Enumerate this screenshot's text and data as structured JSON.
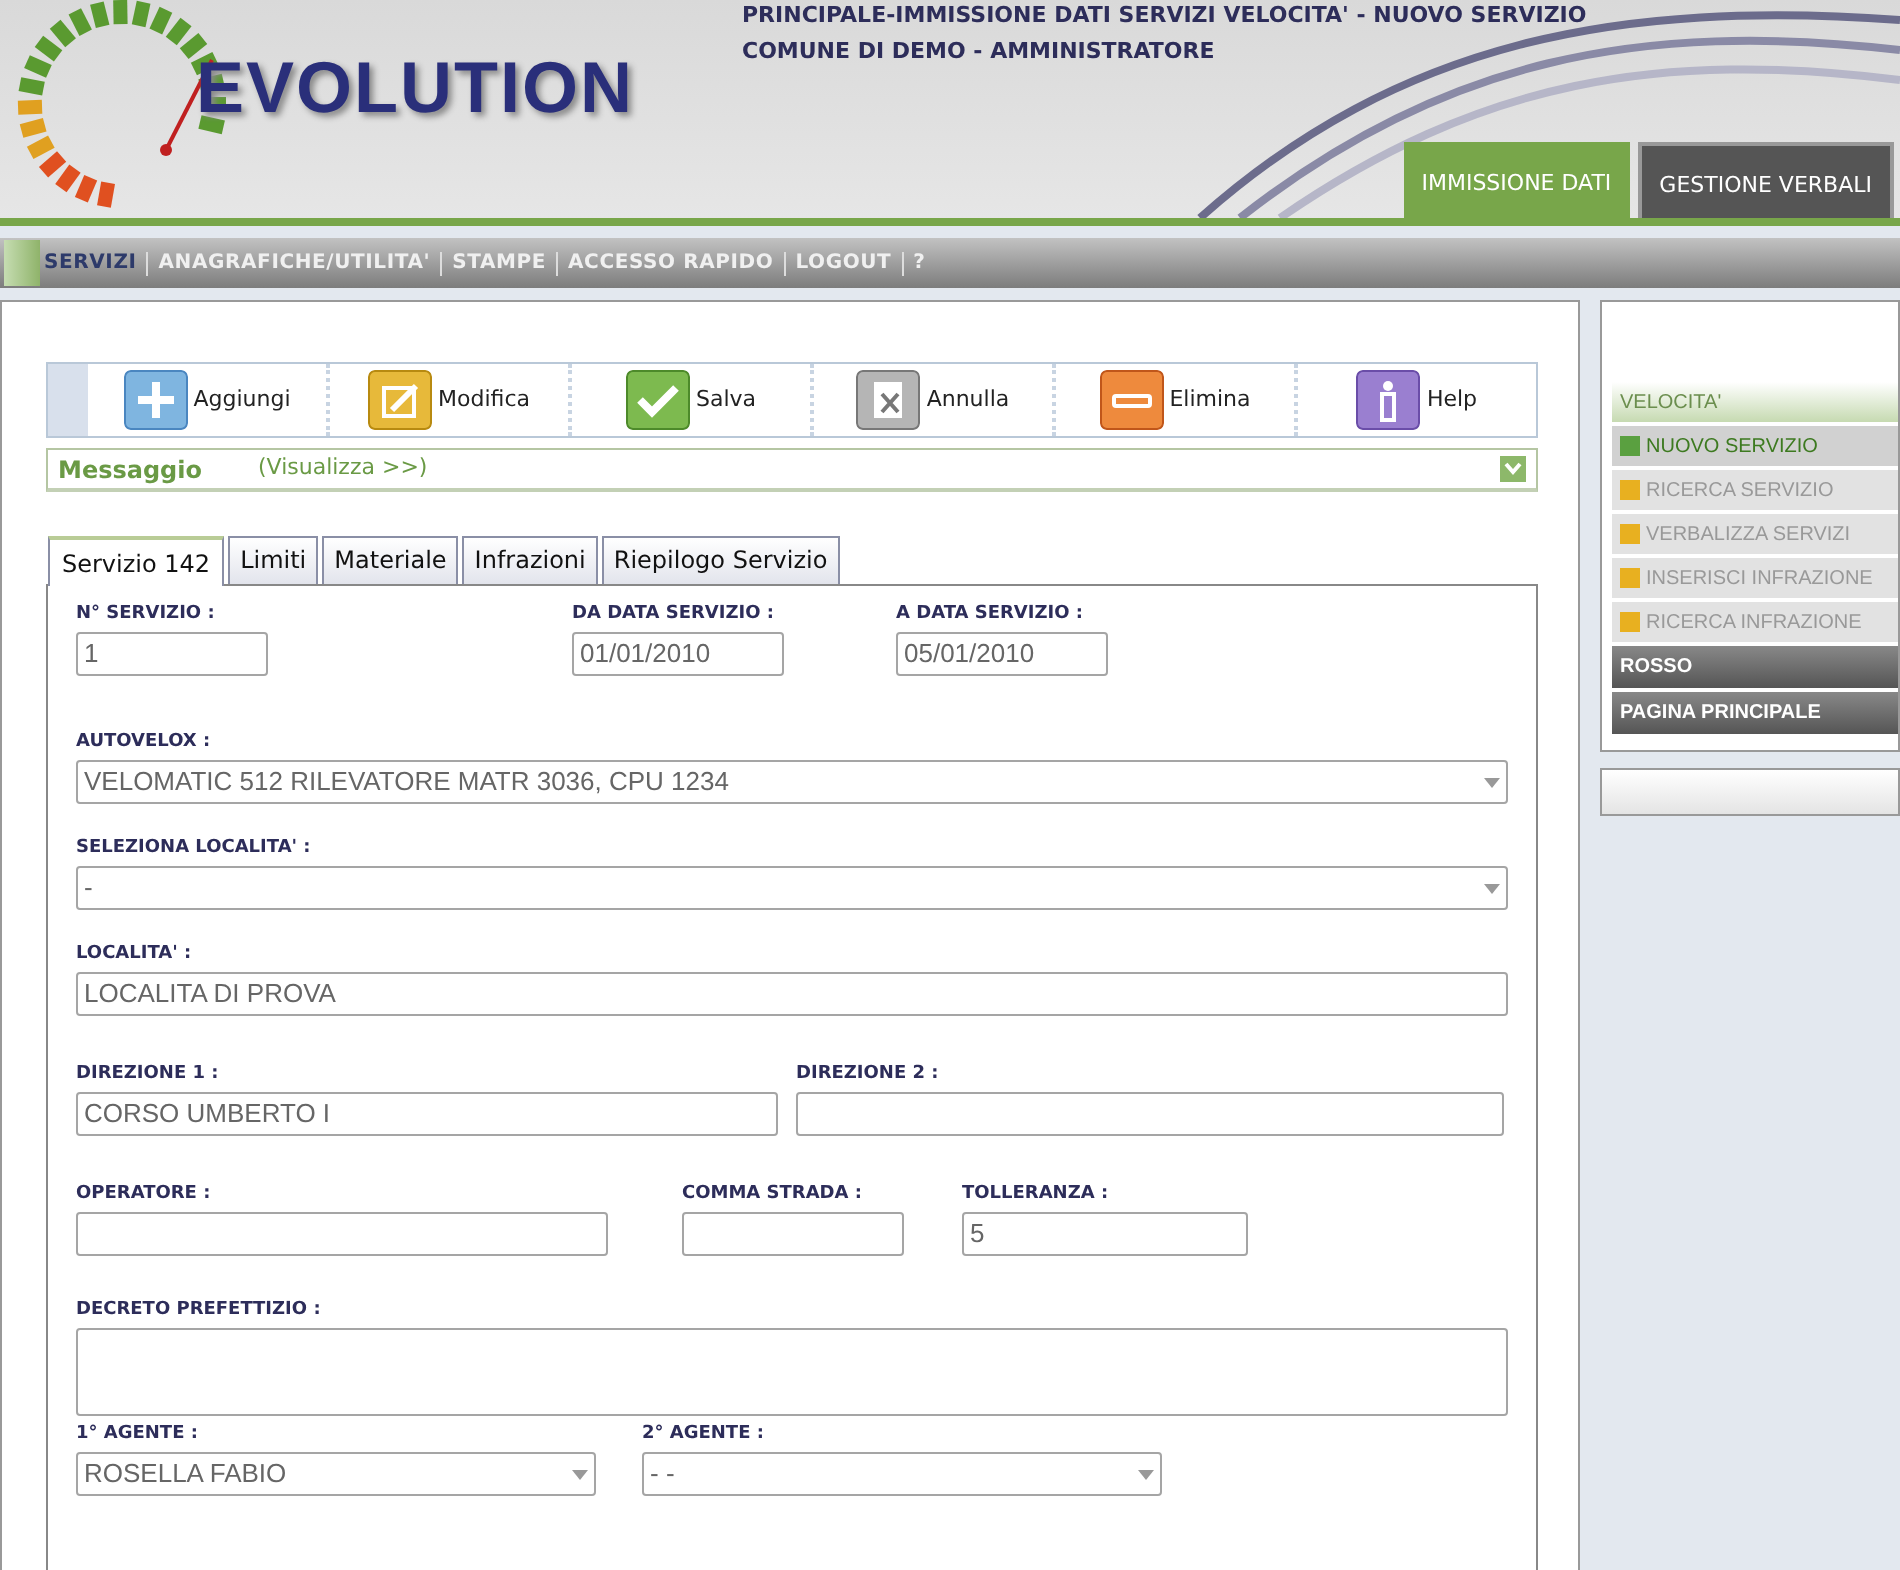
{
  "header": {
    "logo_text": "EVOLUTION",
    "breadcrumb": "PRINCIPALE-IMMISSIONE DATI SERVIZI VELOCITA' - NUOVO SERVIZIO",
    "user_line": "COMUNE DI DEMO - AMMINISTRATORE",
    "tabs": [
      {
        "label": "IMMISSIONE DATI",
        "selected": true
      },
      {
        "label": "GESTIONE VERBALI",
        "selected": false
      }
    ]
  },
  "menu_bar": [
    {
      "label": "SERVIZI",
      "selected": true
    },
    {
      "label": "ANAGRAFICHE/UTILITA'",
      "selected": false
    },
    {
      "label": "STAMPE",
      "selected": false
    },
    {
      "label": "ACCESSO RAPIDO",
      "selected": false
    },
    {
      "label": "LOGOUT",
      "selected": false
    },
    {
      "label": "?",
      "selected": false
    }
  ],
  "toolbar": [
    {
      "label": "Aggiungi",
      "kind": "add"
    },
    {
      "label": "Modifica",
      "kind": "edit"
    },
    {
      "label": "Salva",
      "kind": "save"
    },
    {
      "label": "Annulla",
      "kind": "cancel"
    },
    {
      "label": "Elimina",
      "kind": "delete"
    },
    {
      "label": "Help",
      "kind": "help"
    }
  ],
  "message": {
    "title": "Messaggio",
    "link": "(Visualizza >>)"
  },
  "tabs": [
    {
      "label": "Servizio 142",
      "selected": true
    },
    {
      "label": "Limiti",
      "selected": false
    },
    {
      "label": "Materiale",
      "selected": false
    },
    {
      "label": "Infrazioni",
      "selected": false
    },
    {
      "label": "Riepilogo Servizio",
      "selected": false
    }
  ],
  "form": [
    [
      {
        "label": "N° SERVIZIO :",
        "kind": "input",
        "value": "1"
      },
      {
        "label": "DA DATA SERVIZIO :",
        "kind": "input",
        "value": "01/01/2010"
      },
      {
        "label": "A DATA SERVIZIO :",
        "kind": "input",
        "value": "05/01/2010"
      }
    ],
    [
      {
        "label": "AUTOVELOX :",
        "kind": "select",
        "value": "VELOMATIC 512 RILEVATORE MATR 3036, CPU 1234"
      }
    ],
    [
      {
        "label": "SELEZIONA LOCALITA' :",
        "kind": "select",
        "value": "-"
      }
    ],
    [
      {
        "label": "LOCALITA' :",
        "kind": "input",
        "value": "LOCALITA DI PROVA"
      }
    ],
    [
      {
        "label": "DIREZIONE 1 :",
        "kind": "input",
        "value": "CORSO UMBERTO I"
      },
      {
        "label": "DIREZIONE 2 :",
        "kind": "input"
      }
    ],
    [
      {
        "label": "OPERATORE :",
        "kind": "input"
      },
      {
        "label": "COMMA STRADA :",
        "kind": "input"
      },
      {
        "label": "TOLLERANZA :",
        "kind": "input",
        "value": "5"
      }
    ],
    [
      {
        "label": "DECRETO PREFETTIZIO :",
        "kind": "textarea"
      }
    ],
    [
      {
        "label": "1° AGENTE :",
        "kind": "select",
        "value": "ROSELLA FABIO"
      },
      {
        "label": "2° AGENTE :",
        "kind": "select",
        "value": "- -"
      }
    ]
  ],
  "sidebar": [
    {
      "label": "VELOCITA'",
      "kind": "header"
    },
    {
      "label": "NUOVO SERVIZIO",
      "kind": "item",
      "selected": true
    },
    {
      "label": "RICERCA SERVIZIO",
      "kind": "item",
      "selected": false
    },
    {
      "label": "VERBALIZZA SERVIZI",
      "kind": "item",
      "selected": false
    },
    {
      "label": "INSERISCI INFRAZIONE",
      "kind": "item",
      "selected": false
    },
    {
      "label": "RICERCA INFRAZIONE",
      "kind": "item",
      "selected": false
    },
    {
      "label": "ROSSO",
      "kind": "dark"
    },
    {
      "label": "PAGINA PRINCIPALE",
      "kind": "dark"
    }
  ]
}
